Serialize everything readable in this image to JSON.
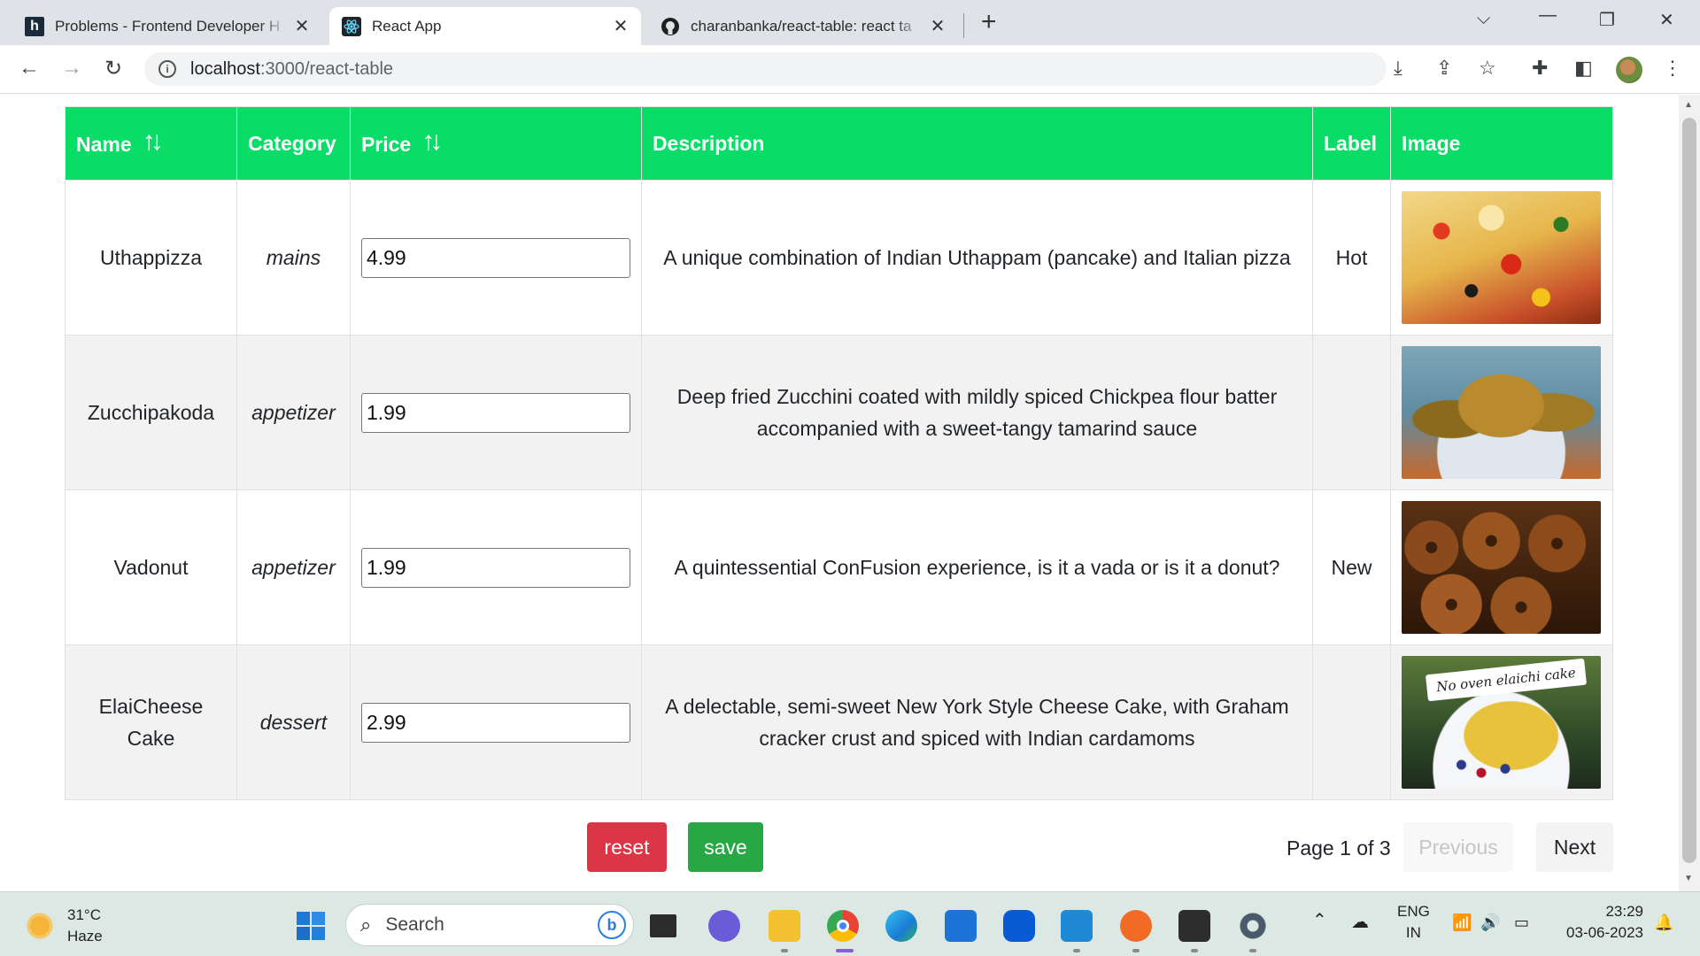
{
  "browser": {
    "tabs": [
      {
        "title": "Problems - Frontend Developer H",
        "favicon": "h"
      },
      {
        "title": "React App",
        "favicon": "react-icon"
      },
      {
        "title": "charanbanka/react-table: react ta",
        "favicon": "github-icon"
      }
    ],
    "url_host": "localhost",
    "url_path": ":3000/react-table"
  },
  "table": {
    "headers": {
      "name": "Name",
      "category": "Category",
      "price": "Price",
      "description": "Description",
      "label": "Label",
      "image": "Image"
    },
    "rows": [
      {
        "name": "Uthappizza",
        "category": "mains",
        "price": "4.99",
        "description": "A unique combination of Indian Uthappam (pancake) and Italian pizza",
        "label": "Hot",
        "image": "pizza"
      },
      {
        "name": "Zucchipakoda",
        "category": "appetizer",
        "price": "1.99",
        "description": "Deep fried Zucchini coated with mildly spiced Chickpea flour batter accompanied with a sweet-tangy tamarind sauce",
        "label": "",
        "image": "pakoda"
      },
      {
        "name": "Vadonut",
        "category": "appetizer",
        "price": "1.99",
        "description": "A quintessential ConFusion experience, is it a vada or is it a donut?",
        "label": "New",
        "image": "donut"
      },
      {
        "name": "ElaiCheese Cake",
        "category": "dessert",
        "price": "2.99",
        "description": "A delectable, semi-sweet New York Style Cheese Cake, with Graham cracker crust and spiced with Indian cardamoms",
        "label": "",
        "image": "cake",
        "image_caption": "No oven elaichi cake"
      }
    ]
  },
  "controls": {
    "reset_label": "reset",
    "save_label": "save",
    "page_text": "Page 1 of 3",
    "previous_label": "Previous",
    "next_label": "Next"
  },
  "colors": {
    "header_bg": "#0adc68",
    "reset_bg": "#dc3545",
    "save_bg": "#28a745"
  },
  "taskbar": {
    "temperature": "31°C",
    "weather": "Haze",
    "search_placeholder": "Search",
    "lang_top": "ENG",
    "lang_bottom": "IN",
    "time": "23:29",
    "date": "03-06-2023"
  }
}
